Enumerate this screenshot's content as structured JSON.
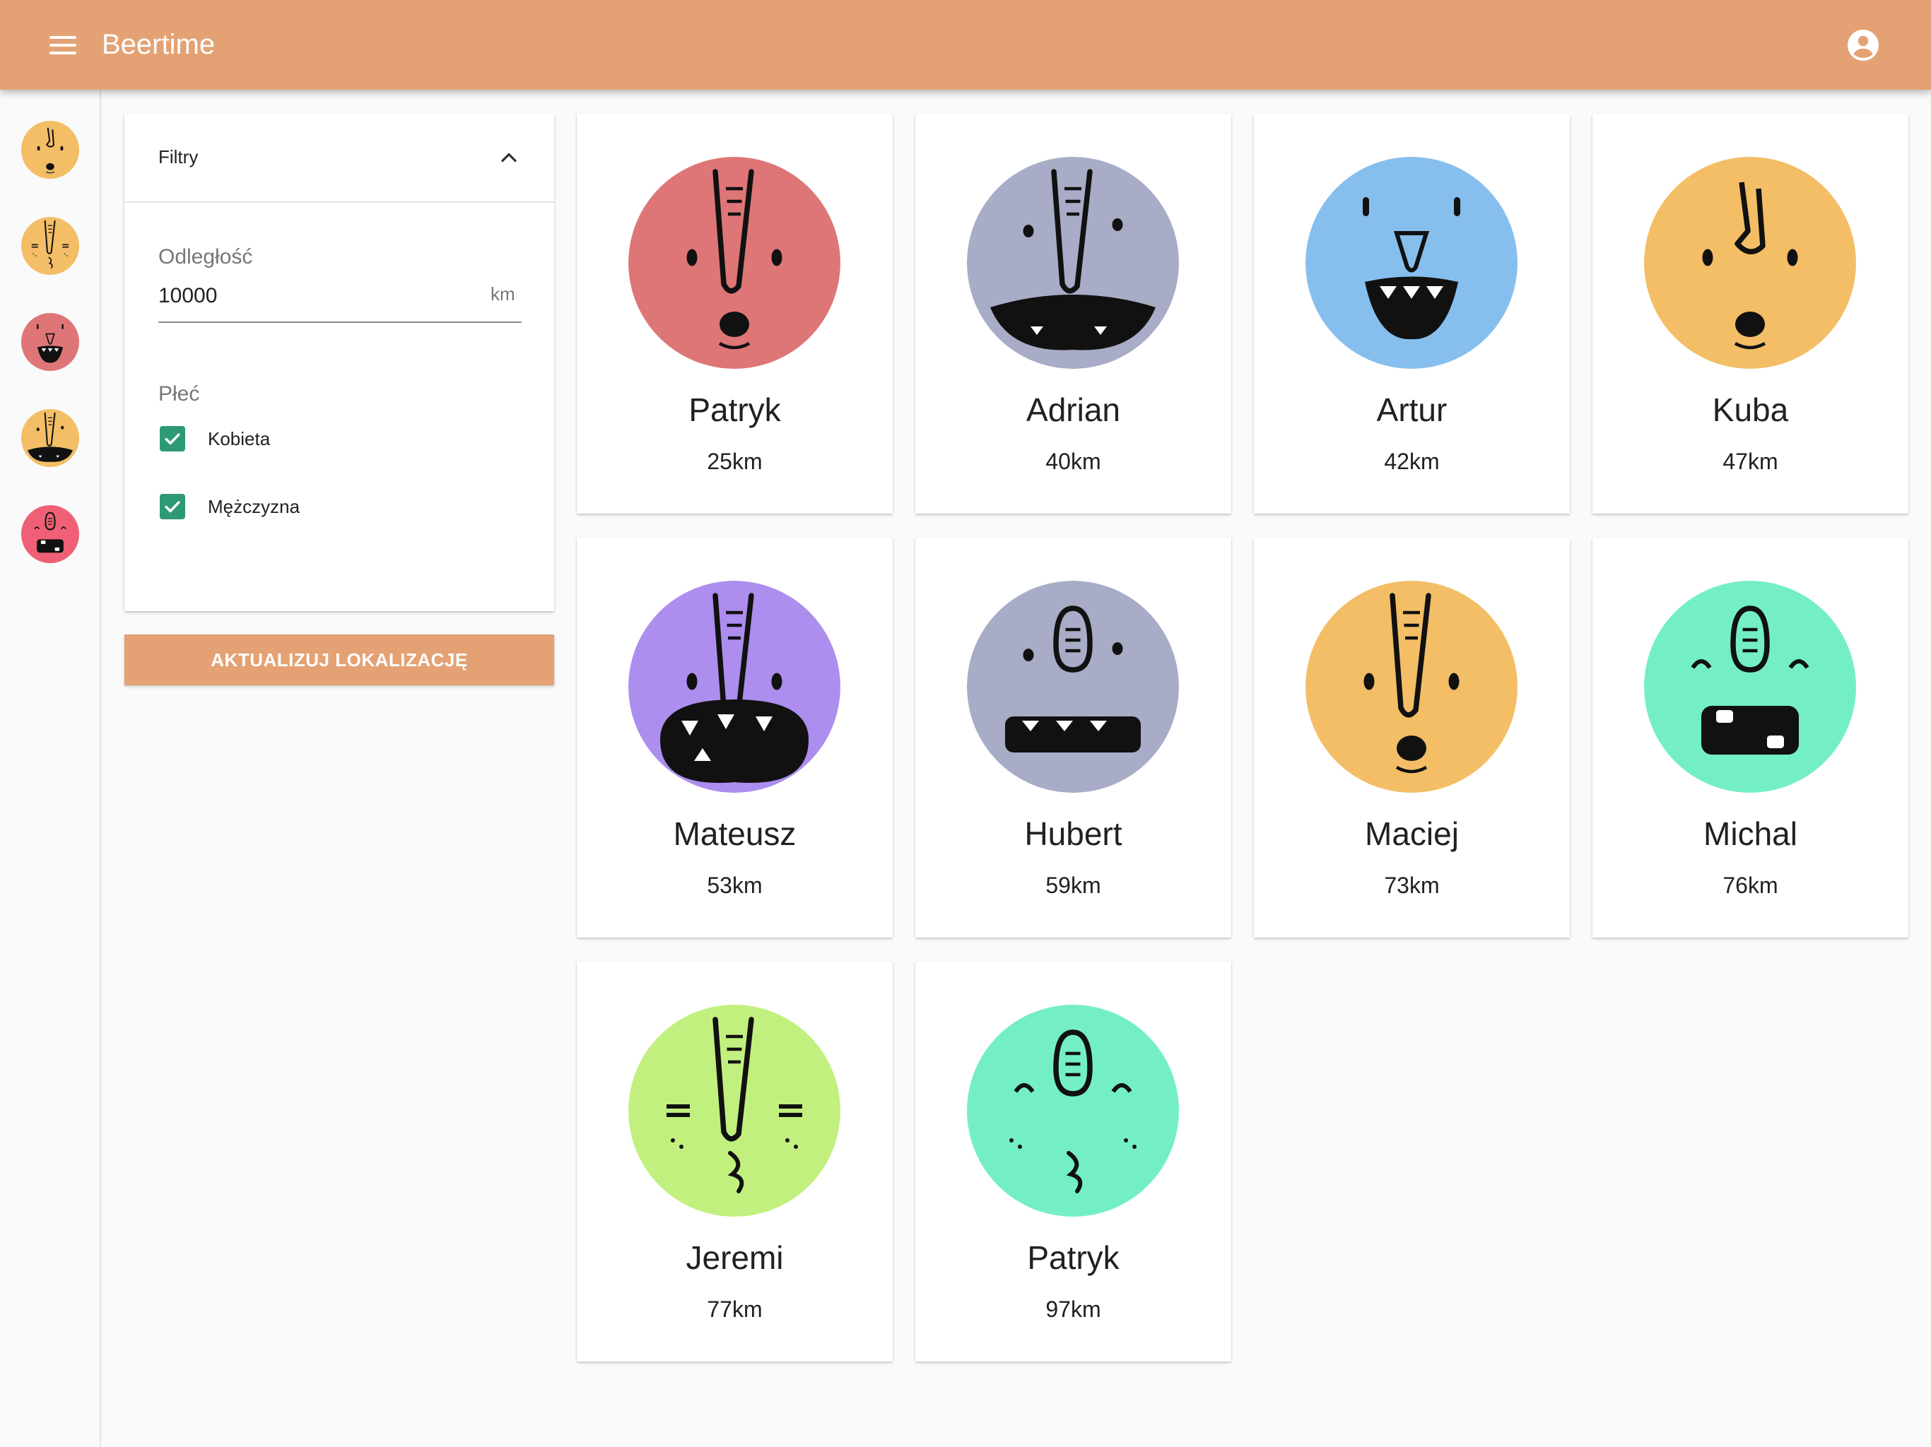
{
  "app": {
    "title": "Beertime"
  },
  "rail": {
    "items": [
      {
        "name": "rail-avatar-1",
        "color": "#f3be66"
      },
      {
        "name": "rail-avatar-2",
        "color": "#f3be66"
      },
      {
        "name": "rail-avatar-3",
        "color": "#de7677"
      },
      {
        "name": "rail-avatar-4",
        "color": "#f3be66"
      },
      {
        "name": "rail-avatar-5",
        "color": "#ef5f75"
      }
    ]
  },
  "filters": {
    "title": "Filtry",
    "distance_label": "Odległość",
    "distance_value": "10000",
    "distance_unit": "km",
    "gender_label": "Płeć",
    "options": [
      {
        "label": "Kobieta",
        "checked": true
      },
      {
        "label": "Mężczyzna",
        "checked": true
      }
    ]
  },
  "update_button": "AKTUALIZUJ LOKALIZACJĘ",
  "people": [
    {
      "name": "Patryk",
      "distance": "25km",
      "color": "#de7677",
      "face": "sad-tall"
    },
    {
      "name": "Adrian",
      "distance": "40km",
      "color": "#a8acc6",
      "face": "grin-tall"
    },
    {
      "name": "Artur",
      "distance": "42km",
      "color": "#86bfee",
      "face": "fangs"
    },
    {
      "name": "Kuba",
      "distance": "47km",
      "color": "#f3be66",
      "face": "surprised"
    },
    {
      "name": "Mateusz",
      "distance": "53km",
      "color": "#ad8ded",
      "face": "big-mouth"
    },
    {
      "name": "Hubert",
      "distance": "59km",
      "color": "#a8acc6",
      "face": "wide-teeth"
    },
    {
      "name": "Maciej",
      "distance": "73km",
      "color": "#f3be66",
      "face": "oh-tall"
    },
    {
      "name": "Michal",
      "distance": "76km",
      "color": "#74efc4",
      "face": "square-mouth"
    },
    {
      "name": "Jeremi",
      "distance": "77km",
      "color": "#c2f07f",
      "face": "calm"
    },
    {
      "name": "Patryk",
      "distance": "97km",
      "color": "#74efc4",
      "face": "calm-round"
    }
  ],
  "colors": {
    "accent": "#e4a274",
    "checkbox": "#2e9a74"
  }
}
